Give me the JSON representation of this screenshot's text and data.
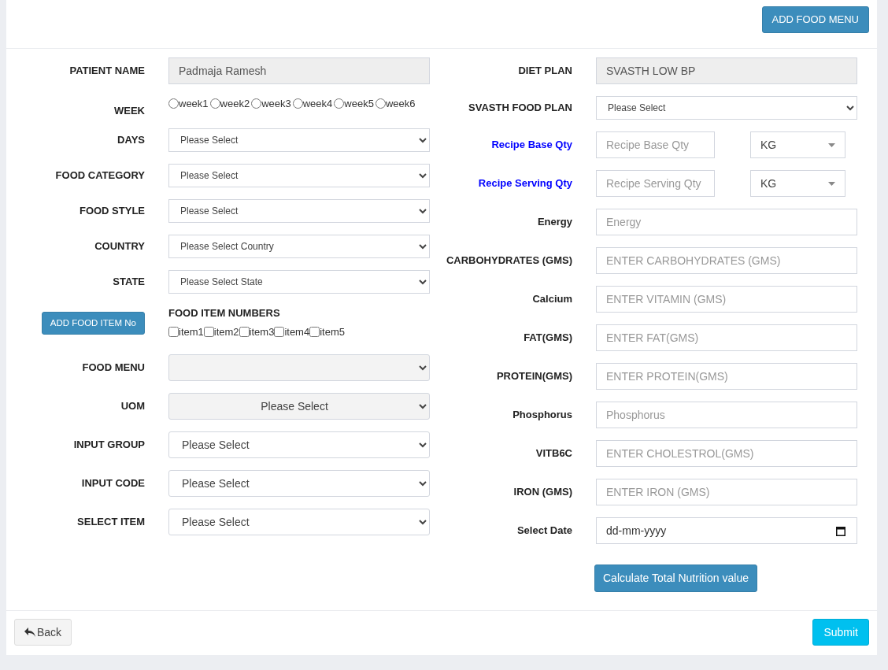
{
  "header": {
    "add_menu_button": "ADD FOOD MENU"
  },
  "left_fields": [
    {
      "kind": "readonly",
      "label": "PATIENT NAME",
      "value": "Padmaja Ramesh"
    },
    {
      "kind": "radios",
      "label": "WEEK",
      "options": [
        {
          "label": "week1",
          "selected": false
        },
        {
          "label": "week2",
          "selected": false
        },
        {
          "label": "week3",
          "selected": false
        },
        {
          "label": "week4",
          "selected": false
        },
        {
          "label": "week5",
          "selected": false
        },
        {
          "label": "week6",
          "selected": false
        }
      ]
    },
    {
      "kind": "compact-select",
      "label": "DAYS",
      "value": "Please Select"
    },
    {
      "kind": "compact-select",
      "label": "FOOD CATEGORY",
      "value": "Please Select"
    },
    {
      "kind": "compact-select",
      "label": "FOOD STYLE",
      "value": "Please Select"
    },
    {
      "kind": "compact-select",
      "label": "COUNTRY",
      "value": "Please Select Country"
    },
    {
      "kind": "compact-select",
      "label": "STATE",
      "value": "Please Select State"
    },
    {
      "kind": "checkboxes",
      "button": "ADD FOOD ITEM No",
      "title": "FOOD ITEM NUMBERS",
      "options": [
        {
          "label": "item1",
          "checked": false
        },
        {
          "label": "item2",
          "checked": false
        },
        {
          "label": "item3",
          "checked": false
        },
        {
          "label": "item4",
          "checked": false
        },
        {
          "label": "item5",
          "checked": false
        }
      ]
    },
    {
      "kind": "select",
      "label": "FOOD MENU",
      "disabled": true
    },
    {
      "kind": "select",
      "label": "UOM",
      "value": "Please Select",
      "disabled": true
    },
    {
      "kind": "select",
      "label": "INPUT GROUP",
      "value": "Please Select",
      "disabled": false
    },
    {
      "kind": "select",
      "label": "INPUT CODE",
      "value": "Please Select",
      "disabled": false
    },
    {
      "kind": "select",
      "label": "SELECT ITEM",
      "value": "Please Select",
      "disabled": false
    }
  ],
  "right_fields": [
    {
      "kind": "readonly",
      "label": "DIET PLAN",
      "value": "SVASTH LOW BP"
    },
    {
      "kind": "compact-select",
      "label": "SVASTH FOOD PLAN",
      "value": "Please Select"
    },
    {
      "kind": "qty",
      "label": "Recipe Base Qty",
      "placeholder": "Recipe Base Qty",
      "unit": "KG"
    },
    {
      "kind": "qty",
      "label": "Recipe Serving Qty",
      "placeholder": "Recipe Serving Qty",
      "unit": "KG"
    },
    {
      "kind": "input",
      "label": "Energy",
      "placeholder": "Energy"
    },
    {
      "kind": "input",
      "label": "CARBOHYDRATES (GMS)",
      "placeholder": "ENTER CARBOHYDRATES (GMS)"
    },
    {
      "kind": "input",
      "label": "Calcium",
      "placeholder": "ENTER VITAMIN (GMS)"
    },
    {
      "kind": "input",
      "label": "FAT(GMS)",
      "placeholder": "ENTER FAT(GMS)"
    },
    {
      "kind": "input",
      "label": "PROTEIN(GMS)",
      "placeholder": "ENTER PROTEIN(GMS)"
    },
    {
      "kind": "input",
      "label": "Phosphorus",
      "placeholder": "Phosphorus"
    },
    {
      "kind": "input",
      "label": "VITB6C",
      "placeholder": "ENTER CHOLESTROL(GMS)"
    },
    {
      "kind": "input",
      "label": "IRON (GMS)",
      "placeholder": "ENTER IRON (GMS)"
    },
    {
      "kind": "date",
      "label": "Select Date",
      "placeholder": "dd-mm-yyyy"
    }
  ],
  "calculate_button": "Calculate Total Nutrition value",
  "footer": {
    "back_button": "Back",
    "submit_button": "Submit"
  }
}
